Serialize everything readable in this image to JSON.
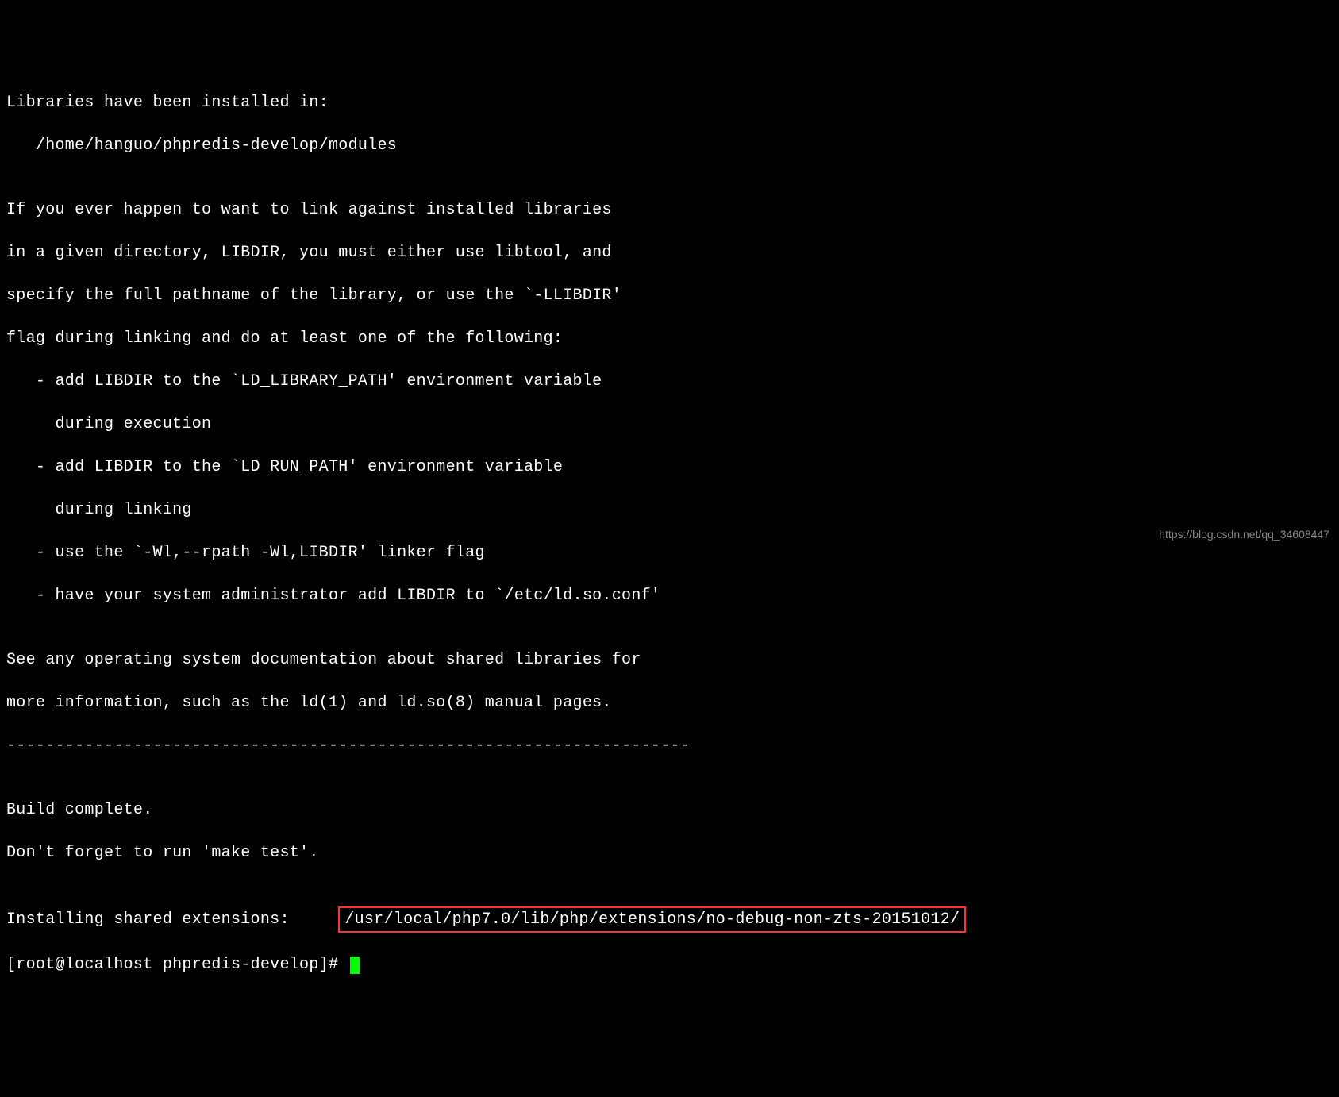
{
  "lines": {
    "l01": "Libraries have been installed in:",
    "l02": "   /home/hanguo/phpredis-develop/modules",
    "l03": "",
    "l04": "If you ever happen to want to link against installed libraries",
    "l05": "in a given directory, LIBDIR, you must either use libtool, and",
    "l06": "specify the full pathname of the library, or use the `-LLIBDIR'",
    "l07": "flag during linking and do at least one of the following:",
    "l08": "   - add LIBDIR to the `LD_LIBRARY_PATH' environment variable",
    "l09": "     during execution",
    "l10": "   - add LIBDIR to the `LD_RUN_PATH' environment variable",
    "l11": "     during linking",
    "l12": "   - use the `-Wl,--rpath -Wl,LIBDIR' linker flag",
    "l13": "   - have your system administrator add LIBDIR to `/etc/ld.so.conf'",
    "l14": "",
    "l15": "See any operating system documentation about shared libraries for",
    "l16": "more information, such as the ld(1) and ld.so(8) manual pages.",
    "l17": "----------------------------------------------------------------------",
    "l18": "",
    "l19": "Build complete.",
    "l20": "Don't forget to run 'make test'.",
    "l21": "",
    "l22_prefix": "Installing shared extensions:     ",
    "l22_path": "/usr/local/php7.0/lib/php/extensions/no-debug-non-zts-20151012/",
    "l23_prompt": "[root@localhost phpredis-develop]# "
  },
  "watermark": "https://blog.csdn.net/qq_34608447"
}
